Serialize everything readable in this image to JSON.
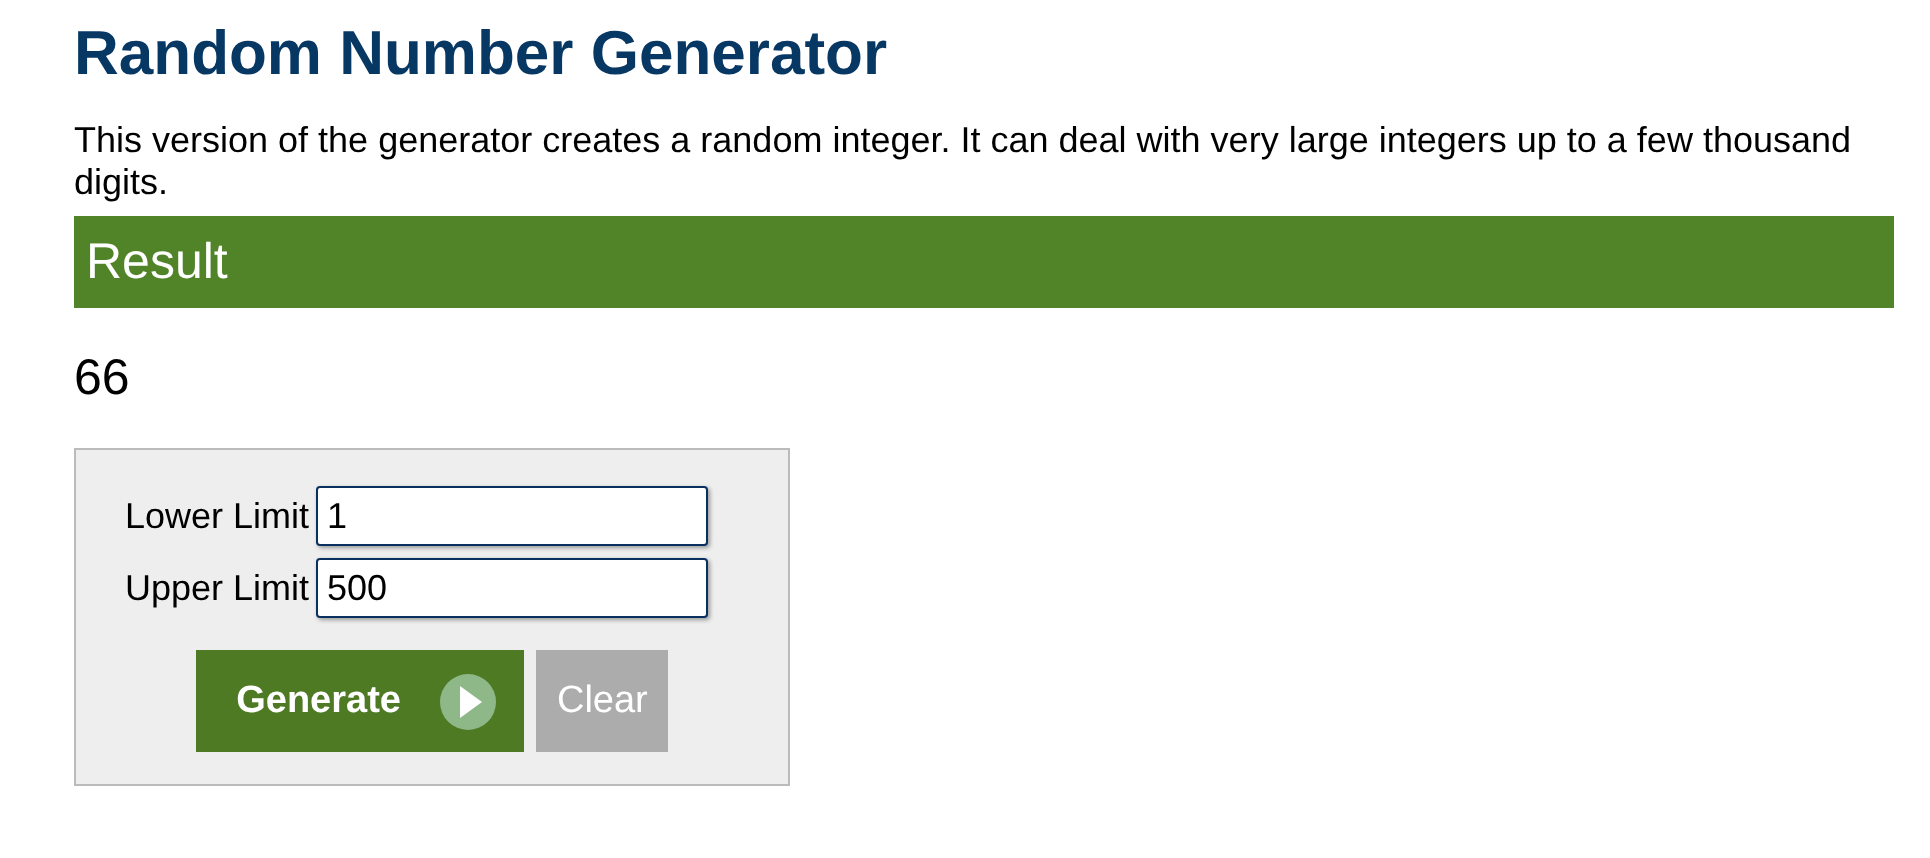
{
  "title": "Random Number Generator",
  "description": "This version of the generator creates a random integer. It can deal with very large integers up to a few thousand digits.",
  "result": {
    "heading": "Result",
    "value": "66"
  },
  "form": {
    "fields": [
      {
        "label": "Lower Limit",
        "value": "1"
      },
      {
        "label": "Upper Limit",
        "value": "500"
      }
    ],
    "buttons": [
      {
        "label": "Generate",
        "kind": "primary"
      },
      {
        "label": "Clear",
        "kind": "secondary"
      }
    ]
  }
}
